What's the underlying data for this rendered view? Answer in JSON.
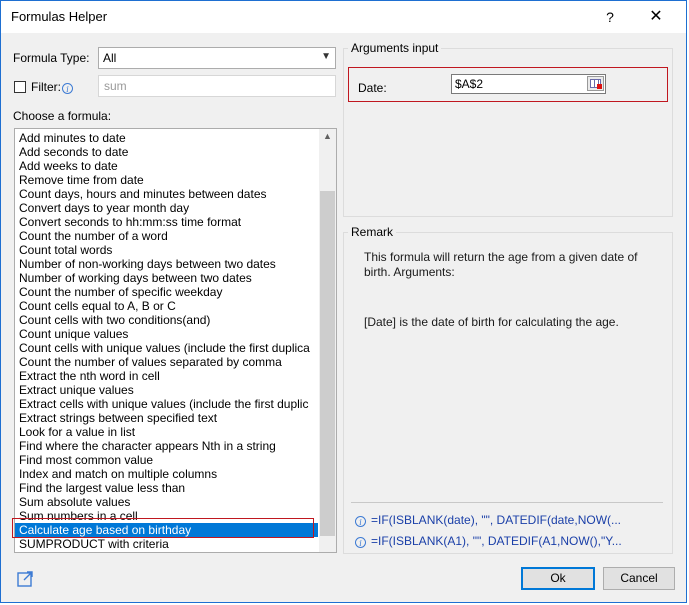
{
  "window": {
    "title": "Formulas Helper",
    "help_label": "?",
    "close_label": "✕"
  },
  "left": {
    "formula_type_label": "Formula Type:",
    "formula_type_value": "All",
    "filter_label": "Filter:",
    "filter_placeholder": "sum",
    "choose_label": "Choose a formula:",
    "items": [
      "Add minutes to date",
      "Add seconds to date",
      "Add weeks to date",
      "Remove time from date",
      "Count days, hours and minutes between dates",
      "Convert days to year month day",
      "Convert seconds to hh:mm:ss time format",
      "Count the number of a word",
      "Count total words",
      "Number of non-working days between two dates",
      "Number of working days between two dates",
      "Count the number of specific weekday",
      "Count cells equal to A, B or C",
      "Count cells with two conditions(and)",
      "Count unique values",
      "Count cells with unique values (include the first duplica",
      "Count the number of values separated by comma",
      "Extract the nth word in cell",
      "Extract unique values",
      "Extract cells with unique values (include the first duplic",
      "Extract strings between specified text",
      "Look for a value in list",
      "Find where the character appears Nth in a string",
      "Find most common value",
      "Index and match on multiple columns",
      "Find the largest value less than",
      "Sum absolute values",
      "Sum numbers in a cell",
      "Calculate age based on birthday",
      "SUMPRODUCT with criteria"
    ],
    "selected_index": 28
  },
  "arguments": {
    "group_title": "Arguments input",
    "date_label": "Date:",
    "date_value": "$A$2"
  },
  "remark": {
    "group_title": "Remark",
    "line1": "This formula will return the age from a given date of",
    "line2": "birth. Arguments:",
    "line3": "[Date] is the date of birth for calculating the age.",
    "formula1": "=IF(ISBLANK(date), \"\", DATEDIF(date,NOW(...",
    "formula2": "=IF(ISBLANK(A1), \"\", DATEDIF(A1,NOW(),\"Y..."
  },
  "buttons": {
    "ok": "Ok",
    "cancel": "Cancel"
  },
  "icons": {
    "info": "info-icon",
    "share": "share-icon",
    "range": "range-select-icon"
  }
}
